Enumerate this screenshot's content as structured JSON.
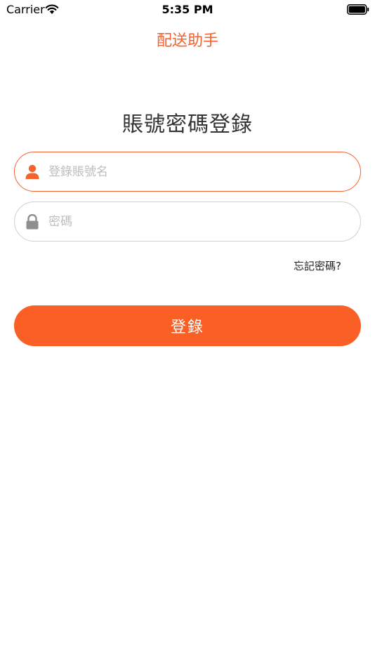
{
  "status_bar": {
    "carrier": "Carrier",
    "time": "5:35 PM"
  },
  "nav": {
    "title": "配送助手"
  },
  "login": {
    "heading": "賬號密碼登錄",
    "username_placeholder": "登錄賬號名",
    "password_placeholder": "密碼",
    "forgot_label": "忘記密碼?",
    "submit_label": "登錄"
  },
  "icons": {
    "username": "user-icon",
    "password": "lock-icon"
  },
  "colors": {
    "accent": "#F5622D",
    "button": "#FA5F25",
    "heading_text": "#333333",
    "placeholder": "#BDBDBD"
  }
}
